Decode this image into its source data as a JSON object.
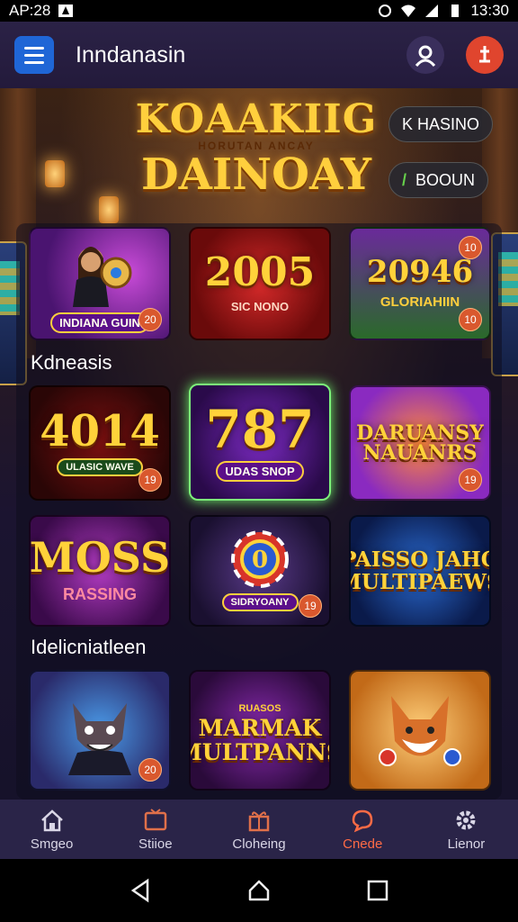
{
  "status_bar": {
    "time": "AP:28",
    "clock": "13:30"
  },
  "app_bar": {
    "title": "Inndanasin"
  },
  "hero": {
    "logo_line1": "KOAAKIIG",
    "logo_sub": "HORUTAN ANCAY",
    "logo_line2": "DAINOAY",
    "chip1": "K HASINO",
    "chip2_mark": "/",
    "chip2": "BOOUN"
  },
  "row1": [
    {
      "caption": "INDIANA GUIN",
      "badge": "20"
    },
    {
      "title": "2005",
      "caption": "SIC NONO"
    },
    {
      "title": "20946",
      "caption": "GLORIAHIIN",
      "badge_top": "10",
      "badge": "10"
    }
  ],
  "section1": "Kdneasis",
  "row2": [
    {
      "title": "4014",
      "caption": "ULASIC WAVE",
      "badge": "19"
    },
    {
      "title": "787",
      "caption": "UDAS SNOP"
    },
    {
      "title": "DARUANSY NAUANRS",
      "badge": "19"
    }
  ],
  "row3": [
    {
      "title": "MOSS",
      "caption": "RASSING"
    },
    {
      "title": "0",
      "caption": "SIDRYOANY",
      "badge": "19"
    },
    {
      "title": "PAISSO JAHO MULTIPAEWS"
    }
  ],
  "section2": "Idelicniatleen",
  "row4": [
    {
      "badge": "20"
    },
    {
      "title": "MARMAK MULTPANNS",
      "caption": "RUASOS"
    },
    {}
  ],
  "bottom_nav": [
    {
      "label": "Smgeo",
      "icon": "home-icon"
    },
    {
      "label": "Stiioe",
      "icon": "tv-icon"
    },
    {
      "label": "Cloheing",
      "icon": "gift-icon"
    },
    {
      "label": "Cnede",
      "icon": "chat-icon",
      "active": true
    },
    {
      "label": "Lienor",
      "icon": "gear-icon"
    }
  ],
  "colors": {
    "accent": "#1f66d6",
    "active": "#ff6b45",
    "nav_bg": "#2a2448"
  }
}
